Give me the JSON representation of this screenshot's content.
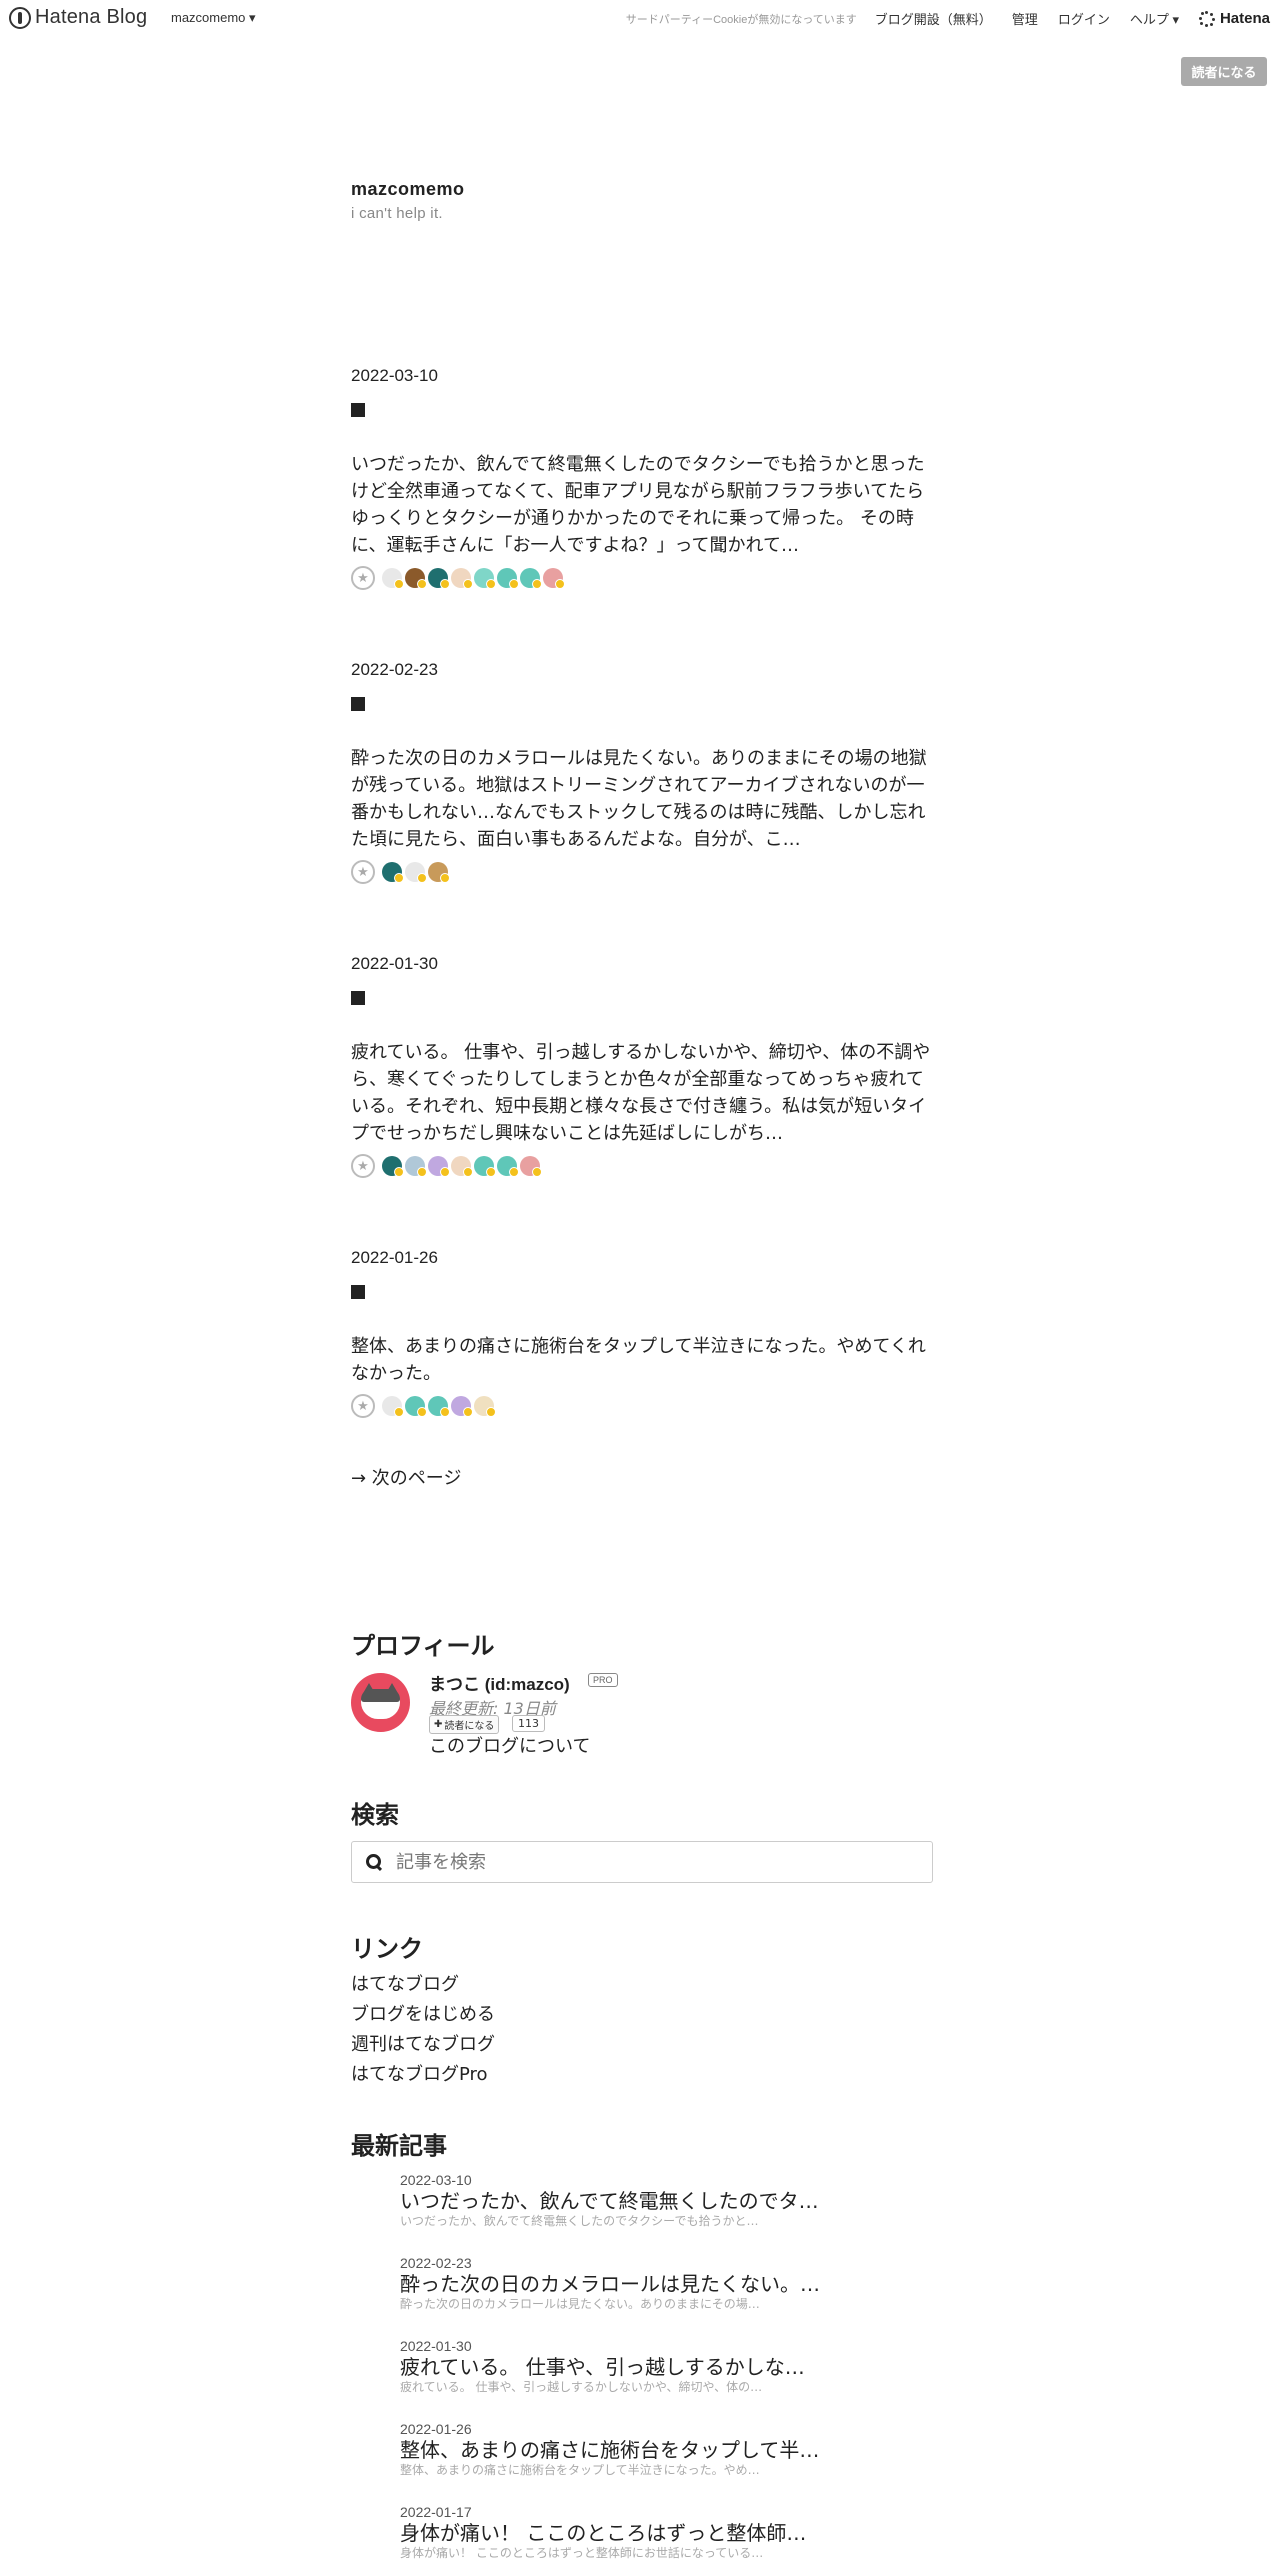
{
  "header": {
    "logo_text": "Hatena Blog",
    "blog_switch": "mazcomemo ▾",
    "cookie_notice": "サードパーティーCookieが無効になっています",
    "open_blog": "ブログ開設（無料）",
    "admin": "管理",
    "login": "ログイン",
    "help": "ヘルプ ▾",
    "brand": "Hatena",
    "subscribe_button": "読者になる"
  },
  "blog": {
    "title": "mazcomemo",
    "description": "i can't help it."
  },
  "entries": [
    {
      "date": "2022-03-10",
      "body": "いつだったか、飲んでて終電無くしたのでタクシーでも拾うかと思ったけど全然車通ってなくて、配車アプリ見ながら駅前フラフラ歩いてたらゆっくりとタクシーが通りかかったのでそれに乗って帰った。 その時に、運転手さんに「お一人ですよね？」って聞かれて…"
    },
    {
      "date": "2022-02-23",
      "body": "酔った次の日のカメラロールは見たくない。ありのままにその場の地獄が残っている。地獄はストリーミングされてアーカイブされないのが一番かもしれない…なんでもストックして残るのは時に残酷、しかし忘れた頃に見たら、面白い事もあるんだよな。自分が、こ…"
    },
    {
      "date": "2022-01-30",
      "body": "疲れている。 仕事や、引っ越しするかしないかや、締切や、体の不調やら、寒くてぐったりしてしまうとか色々が全部重なってめっちゃ疲れている。それぞれ、短中長期と様々な長さで付き纏う。私は気が短いタイプでせっかちだし興味ないことは先延ばしにしがち…"
    },
    {
      "date": "2022-01-26",
      "body": "整体、あまりの痛さに施術台をタップして半泣きになった。やめてくれなかった。"
    }
  ],
  "pagination": {
    "next": "→  次のページ"
  },
  "profile": {
    "section_title": "プロフィール",
    "name": "まつこ (id:mazco)",
    "badge": "PRO",
    "last_updated": "最終更新: 13日前",
    "subscribe": "読者になる",
    "subscriber_count": "113",
    "about": "このブログについて"
  },
  "search": {
    "section_title": "検索",
    "placeholder": "記事を検索"
  },
  "links": {
    "section_title": "リンク",
    "items": [
      "はてなブログ",
      "ブログをはじめる",
      "週刊はてなブログ",
      "はてなブログPro"
    ]
  },
  "recent": {
    "section_title": "最新記事",
    "items": [
      {
        "date": "2022-03-10",
        "title": "いつだったか、飲んでて終電無くしたのでタ…",
        "snippet": "いつだったか、飲んでて終電無くしたのでタクシーでも拾うかと…"
      },
      {
        "date": "2022-02-23",
        "title": "酔った次の日のカメラロールは見たくない。…",
        "snippet": "酔った次の日のカメラロールは見たくない。ありのままにその場…"
      },
      {
        "date": "2022-01-30",
        "title": "疲れている。 仕事や、引っ越しするかしな…",
        "snippet": "疲れている。 仕事や、引っ越しするかしないかや、締切や、体の…"
      },
      {
        "date": "2022-01-26",
        "title": "整体、あまりの痛さに施術台をタップして半…",
        "snippet": "整体、あまりの痛さに施術台をタップして半泣きになった。やめ…"
      },
      {
        "date": "2022-01-17",
        "title": "身体が痛い！ ここのところはずっと整体師…",
        "snippet": "身体が痛い！ ここのところはずっと整体師にお世話になっている…"
      }
    ]
  },
  "colors": {
    "star_avatars_1": [
      "#e8e8e8",
      "#8b5a2b",
      "#1f6f6f",
      "#f0d7c0",
      "#7fd6c8",
      "#5fc7b8",
      "#5fc7b8",
      "#e8a0a0"
    ],
    "star_avatars_2": [
      "#1f6f6f",
      "#e8e8e8",
      "#c89a5a"
    ],
    "star_avatars_3": [
      "#1f6f6f",
      "#b0c8d8",
      "#c0a8e0",
      "#f0d7c0",
      "#5fc7b8",
      "#5fc7b8",
      "#e8a0a0"
    ],
    "star_avatars_4": [
      "#e8e8e8",
      "#5fc7b8",
      "#5fc7b8",
      "#c0a8e0",
      "#f0e0c0"
    ]
  }
}
